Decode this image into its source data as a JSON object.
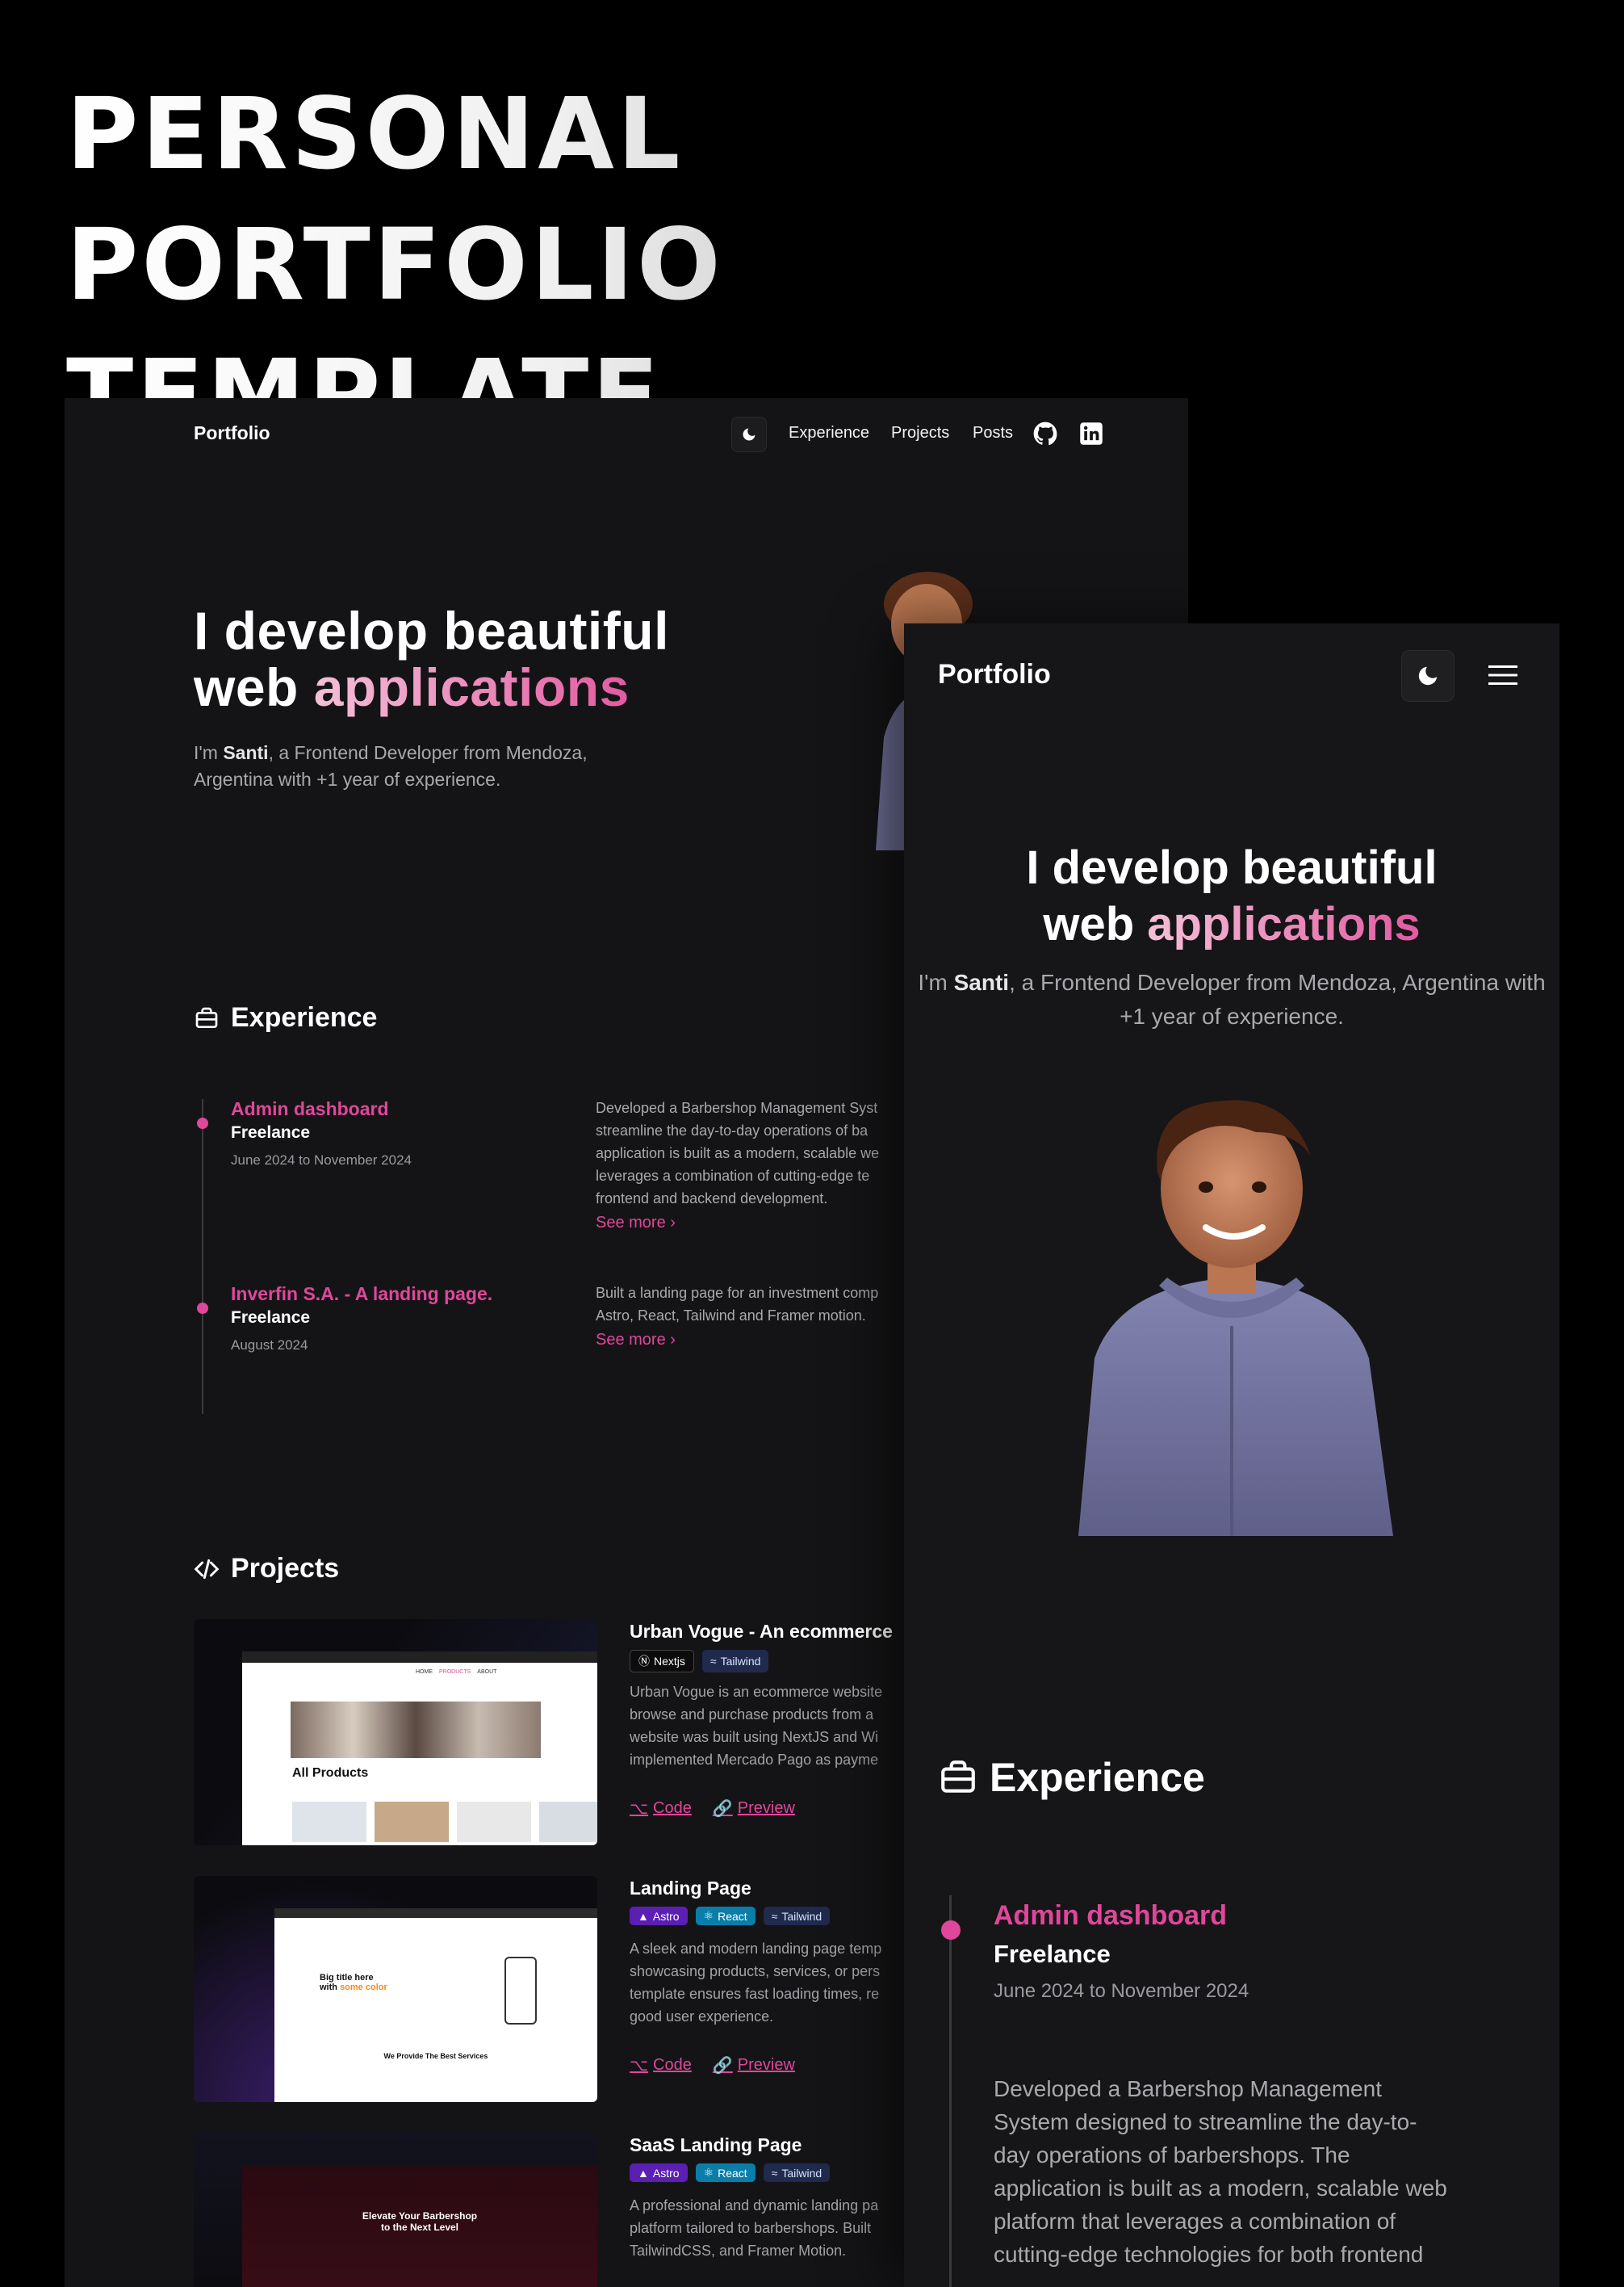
{
  "poster": {
    "title_line1": "PERSONAL PORTFOLIO",
    "title_line2": "TEMPLATE"
  },
  "nav": {
    "logo": "Portfolio",
    "links": [
      "Experience",
      "Projects",
      "Posts"
    ]
  },
  "hero": {
    "title_line1": "I develop beautiful",
    "title_word": "web",
    "title_accent": "applications",
    "sub_prefix": "I'm ",
    "sub_name": "Santi",
    "sub_rest": ", a Frontend Developer from Mendoza, Argentina with +1 year of experience."
  },
  "experience": {
    "heading": "Experience",
    "items": [
      {
        "title": "Admin dashboard",
        "role": "Freelance",
        "date": "June 2024 to November 2024",
        "desc_desktop": "Developed a Barbershop Management Syst\nstreamline the day-to-day operations of ba\napplication is built as a modern, scalable we\nleverages a combination of cutting-edge te\nfrontend and backend development.",
        "desc_mobile": "Developed a Barbershop Management\nSystem designed to streamline the day-to-\nday operations of barbershops. The\napplication is built as a modern, scalable web\nplatform that leverages a combination of\ncutting-edge technologies for both frontend",
        "see_more": "See more ›"
      },
      {
        "title": "Inverfin S.A. - A landing page.",
        "role": "Freelance",
        "date": "August 2024",
        "desc_desktop": "Built a landing page for an investment comp\nAstro, React, Tailwind and Framer motion.",
        "see_more": "See more ›"
      }
    ]
  },
  "projects": {
    "heading": "Projects",
    "items": [
      {
        "title": "Urban Vogue - An ecommerce",
        "tags": [
          "Nextjs",
          "Tailwind"
        ],
        "desc": "Urban Vogue is an ecommerce website\nbrowse and purchase products from a\nwebsite was built using NextJS and Wi\nimplemented Mercado Pago as payme",
        "code": "Code",
        "preview": "Preview",
        "screenshot_heading": "All Products",
        "screenshot_nav": [
          "HOME",
          "PRODUCTS",
          "ABOUT"
        ]
      },
      {
        "title": "Landing Page",
        "tags": [
          "Astro",
          "React",
          "Tailwind"
        ],
        "desc": "A sleek and modern landing page temp\nshowcasing products, services, or pers\ntemplate ensures fast loading times, re\ngood user experience.",
        "code": "Code",
        "preview": "Preview",
        "screenshot_heading_a": "Big title here",
        "screenshot_heading_b": "with",
        "screenshot_heading_c": "some color",
        "screenshot_services": "We Provide The Best Services"
      },
      {
        "title": "SaaS Landing Page",
        "tags": [
          "Astro",
          "React",
          "Tailwind"
        ],
        "desc": "A professional and dynamic landing pa\nplatform tailored to barbershops. Built \nTailwindCSS, and Framer Motion.",
        "screenshot_heading_a": "Elevate Your Barbershop",
        "screenshot_heading_b": "to the Next Level"
      }
    ]
  },
  "colors": {
    "accent": "#e0479a",
    "bg": "#141416",
    "accent_light": "#f4c0d6"
  }
}
